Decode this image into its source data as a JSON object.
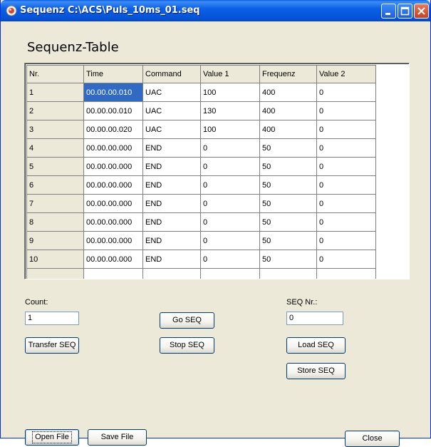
{
  "window": {
    "title": "Sequenz C:\\ACS\\Puls_10ms_01.seq",
    "controls": {
      "minimize_icon": "minimize-icon",
      "maximize_icon": "maximize-icon",
      "close_icon": "close-icon"
    }
  },
  "heading": "Sequenz-Table",
  "table": {
    "columns": [
      "Nr.",
      "Time",
      "Command",
      "Value 1",
      "Frequenz",
      "Value 2"
    ],
    "rows": [
      [
        "1",
        "00.00.00.010",
        "UAC",
        "100",
        "400",
        "0"
      ],
      [
        "2",
        "00.00.00.010",
        "UAC",
        "130",
        "400",
        "0"
      ],
      [
        "3",
        "00.00.00.020",
        "UAC",
        "100",
        "400",
        "0"
      ],
      [
        "4",
        "00.00.00.000",
        "END",
        "0",
        "50",
        "0"
      ],
      [
        "5",
        "00.00.00.000",
        "END",
        "0",
        "50",
        "0"
      ],
      [
        "6",
        "00.00.00.000",
        "END",
        "0",
        "50",
        "0"
      ],
      [
        "7",
        "00.00.00.000",
        "END",
        "0",
        "50",
        "0"
      ],
      [
        "8",
        "00.00.00.000",
        "END",
        "0",
        "50",
        "0"
      ],
      [
        "9",
        "00.00.00.000",
        "END",
        "0",
        "50",
        "0"
      ],
      [
        "10",
        "00.00.00.000",
        "END",
        "0",
        "50",
        "0"
      ]
    ],
    "selected_row": 0,
    "selected_col": 1
  },
  "count": {
    "label": "Count:",
    "value": "1"
  },
  "seq_nr": {
    "label": "SEQ Nr.:",
    "value": "0"
  },
  "buttons": {
    "transfer_seq": "Transfer SEQ",
    "go_seq": "Go SEQ",
    "stop_seq": "Stop SEQ",
    "load_seq": "Load SEQ",
    "store_seq": "Store SEQ",
    "open_file": "Open File",
    "save_file": "Save File",
    "close": "Close"
  },
  "colors": {
    "titlebar": "#0a61e8",
    "selection": "#316ac5",
    "face": "#ece9d8"
  }
}
